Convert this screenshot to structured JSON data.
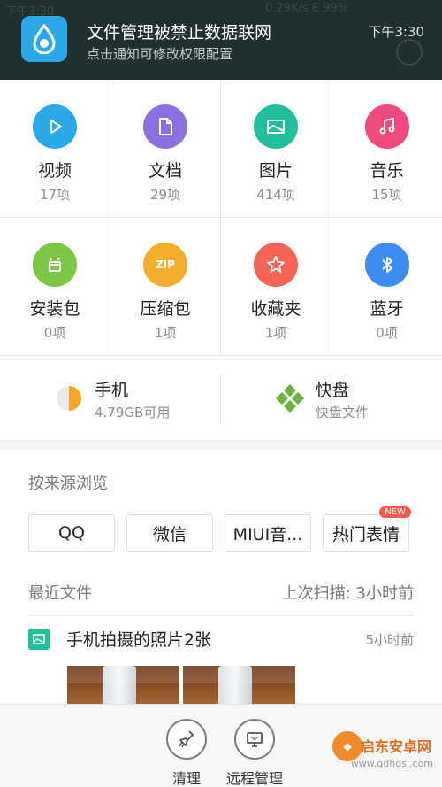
{
  "notification": {
    "title": "文件管理被禁止数据联网",
    "subtitle": "点击通知可修改权限配置",
    "time": "下午3:30",
    "status_bg": "0.29K/s  E  99%",
    "status_time_bg": "下午3:30"
  },
  "categories": [
    {
      "label": "视频",
      "count": "17项",
      "color": "#2aa8ea",
      "icon": "play-icon"
    },
    {
      "label": "文档",
      "count": "29项",
      "color": "#8c6fe0",
      "icon": "document-icon"
    },
    {
      "label": "图片",
      "count": "414项",
      "color": "#21bf9a",
      "icon": "image-icon"
    },
    {
      "label": "音乐",
      "count": "15项",
      "color": "#f0497d",
      "icon": "music-icon"
    },
    {
      "label": "安装包",
      "count": "0项",
      "color": "#7cc744",
      "icon": "android-icon"
    },
    {
      "label": "压缩包",
      "count": "1项",
      "color": "#f3ad2c",
      "icon": "zip-icon",
      "icon_text": "ZIP"
    },
    {
      "label": "收藏夹",
      "count": "1项",
      "color": "#f56454",
      "icon": "star-icon"
    },
    {
      "label": "蓝牙",
      "count": "0项",
      "color": "#3d8df0",
      "icon": "bluetooth-icon"
    }
  ],
  "storage": {
    "phone": {
      "name": "手机",
      "sub": "4.79GB可用",
      "usage": 0.5,
      "fill_color": "#f5a623"
    },
    "kuaipan": {
      "name": "快盘",
      "sub": "快盘文件",
      "color": "#6db33f"
    }
  },
  "source": {
    "title": "按来源浏览",
    "chips": [
      {
        "label": "QQ"
      },
      {
        "label": "微信"
      },
      {
        "label": "MIUI音..."
      },
      {
        "label": "热门表情",
        "badge": "NEW"
      }
    ]
  },
  "recent": {
    "title": "最近文件",
    "scan": "上次扫描: 3小时前",
    "item": {
      "name": "手机拍摄的照片2张",
      "time": "5小时前"
    }
  },
  "bottom": {
    "clean": "清理",
    "remote": "远程管理",
    "watermark_name": "启东安卓网",
    "watermark_url": "www.qdhdsj.com"
  }
}
